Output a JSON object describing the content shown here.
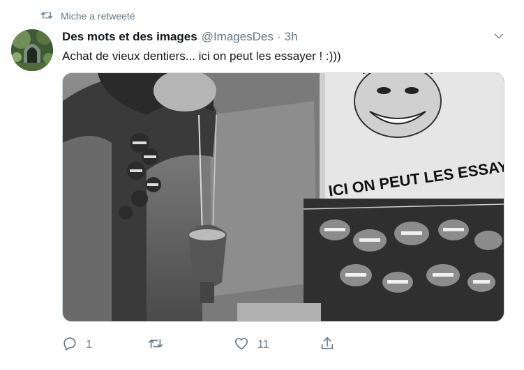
{
  "retweet_context": {
    "text": "Miche a retweeté",
    "icon": "retweet-icon"
  },
  "author": {
    "name": "Des mots et des images",
    "handle": "@ImagesDes",
    "separator": "·",
    "time": "3h"
  },
  "tweet": {
    "text": "Achat de vieux dentiers... ici on peut les essayer !  :)))"
  },
  "media": {
    "sign_text": "ICI ON PEUT LES ESSAYER"
  },
  "actions": {
    "reply_count": "1",
    "retweet_count": "",
    "like_count": "11",
    "share_count": ""
  },
  "colors": {
    "text_primary": "#14171a",
    "text_secondary": "#657786",
    "border": "#ccd6dd"
  }
}
